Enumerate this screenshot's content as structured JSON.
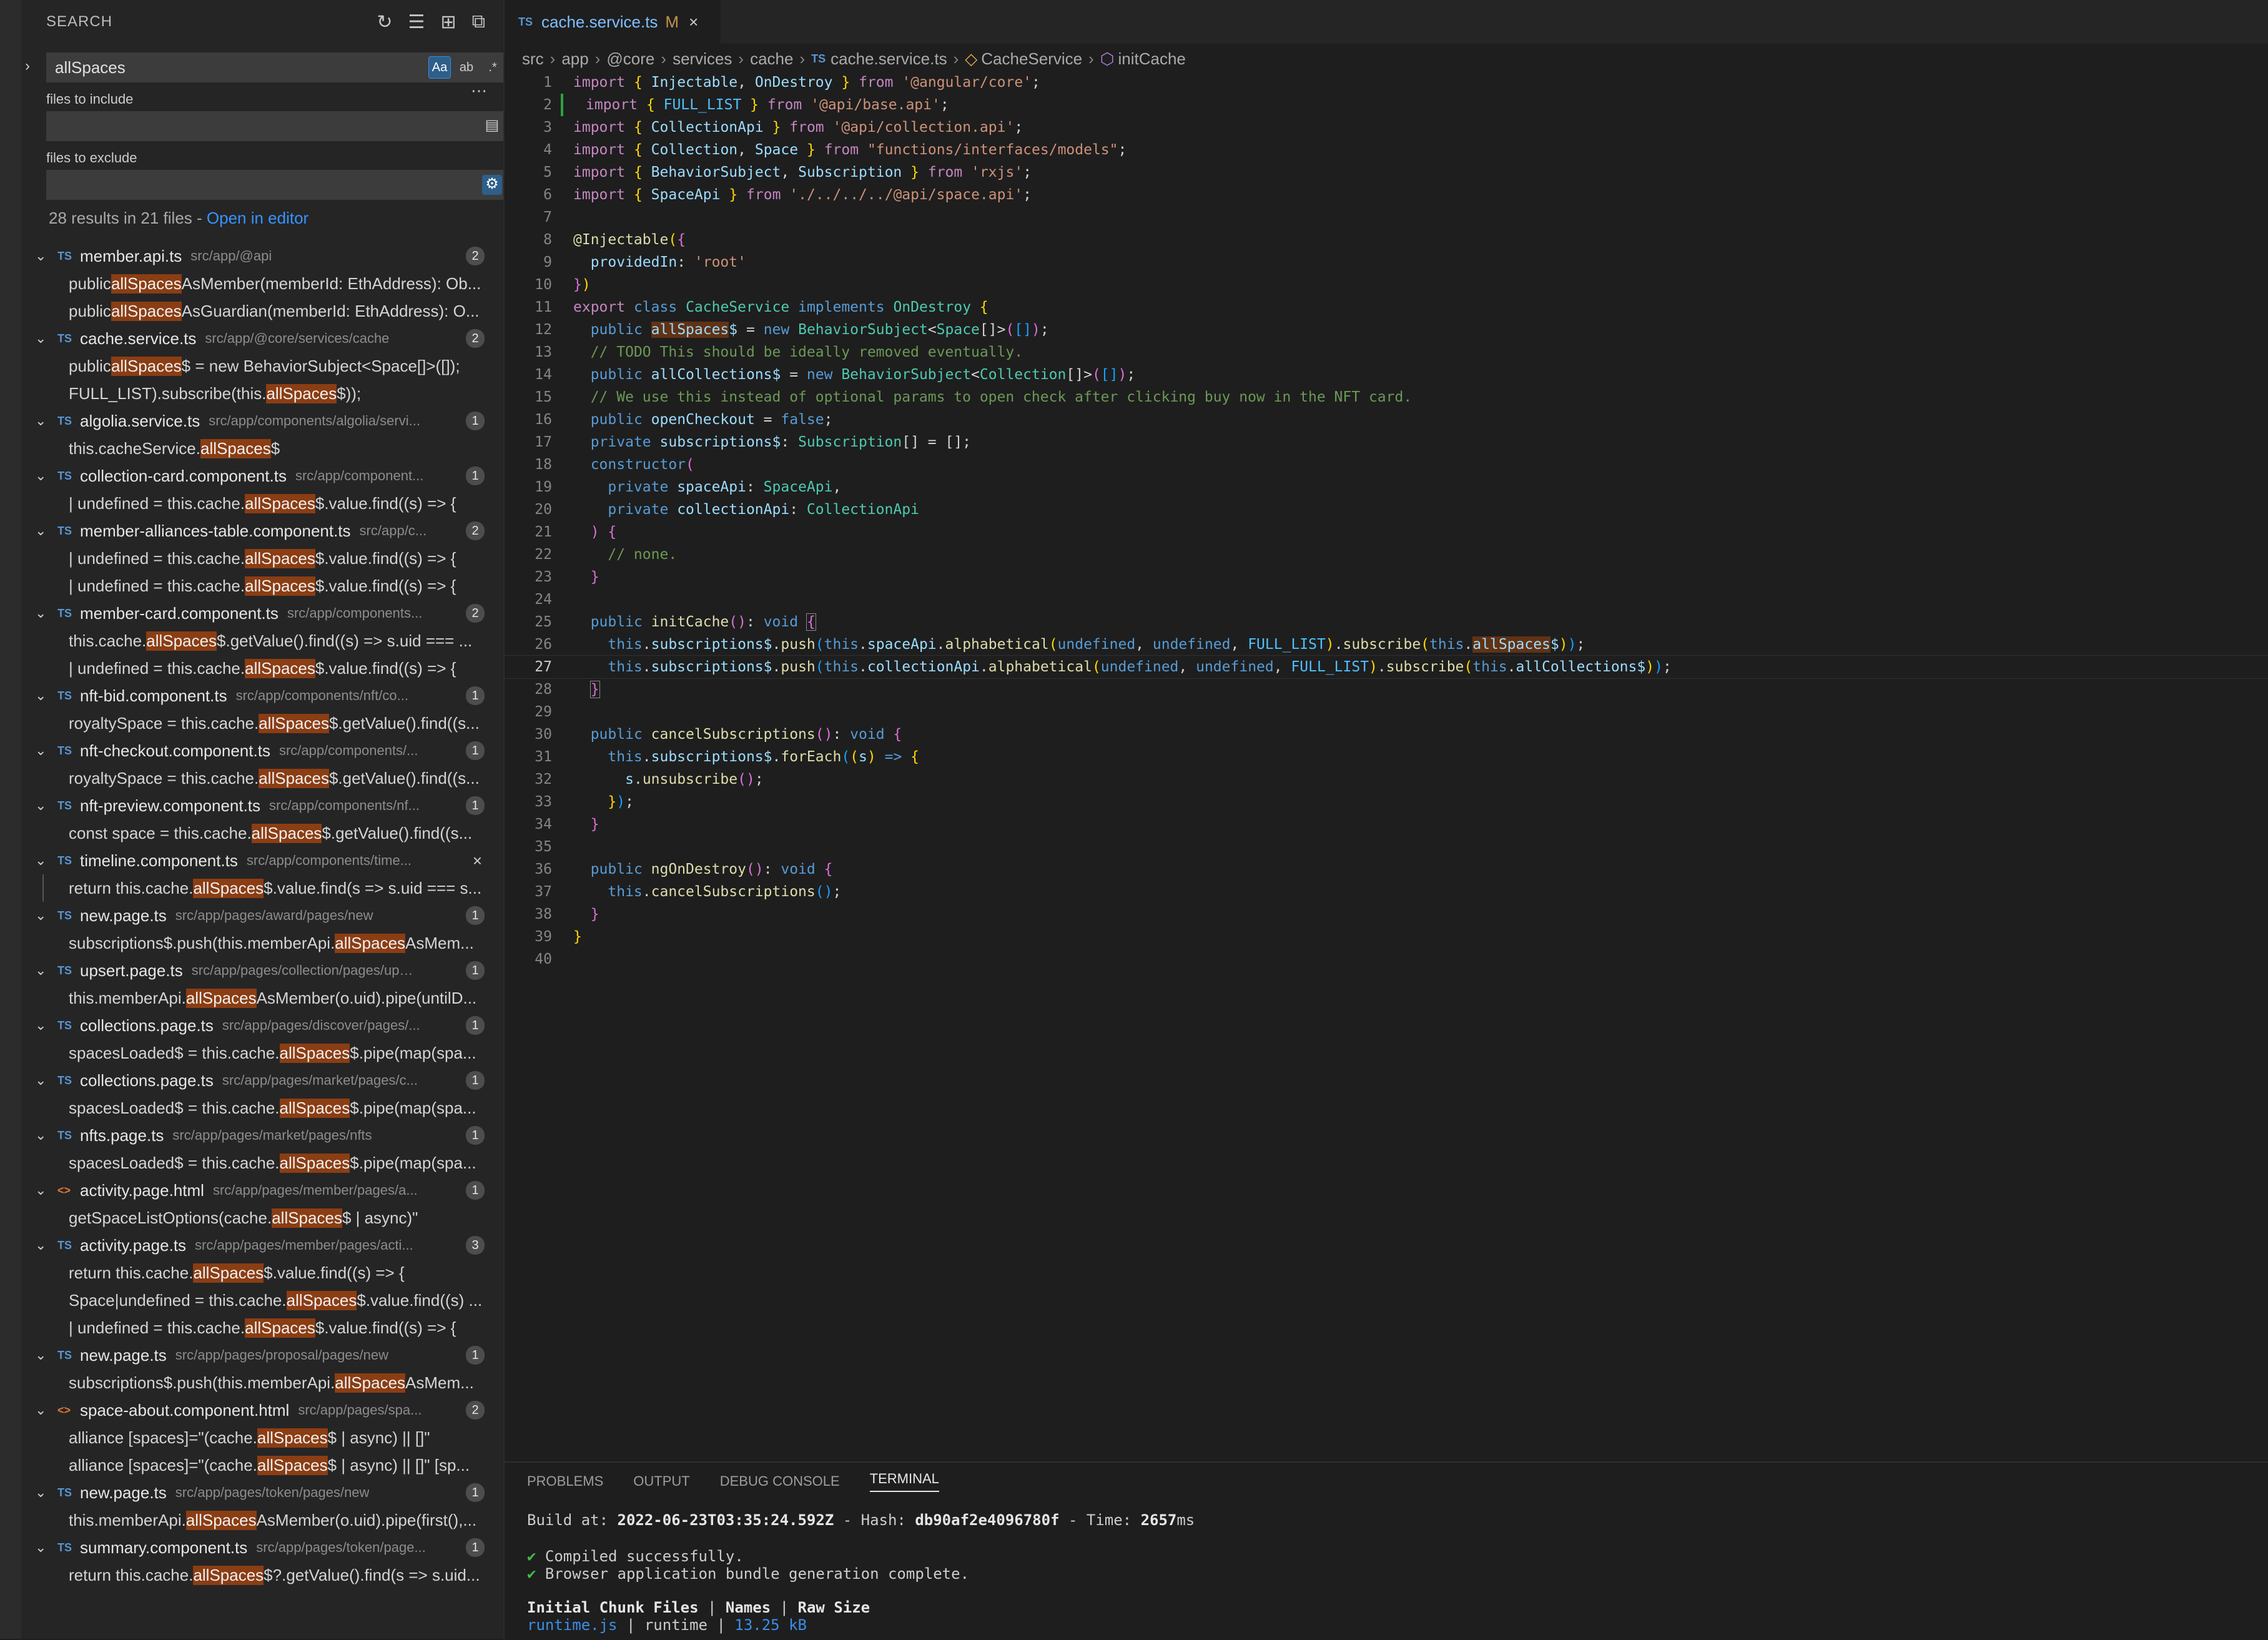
{
  "sidebar": {
    "title": "SEARCH",
    "search_query": "allSpaces",
    "options": {
      "match_case": "Aa",
      "whole_word": "ab",
      "regex": ".*"
    },
    "include_label": "files to include",
    "include_value": "",
    "exclude_label": "files to exclude",
    "exclude_value": "",
    "summary_text": "28 results in 21 files - ",
    "open_in_editor": "Open in editor",
    "results": [
      {
        "name": "member.api.ts",
        "path": "src/app/@api",
        "count": "2",
        "type": "TS",
        "matches": [
          [
            "public ",
            "allSpaces",
            "AsMember(memberId: EthAddress): Ob..."
          ],
          [
            "public ",
            "allSpaces",
            "AsGuardian(memberId: EthAddress): O..."
          ]
        ]
      },
      {
        "name": "cache.service.ts",
        "path": "src/app/@core/services/cache",
        "count": "2",
        "type": "TS",
        "matches": [
          [
            "public ",
            "allSpaces",
            "$ = new BehaviorSubject<Space[]>([]);"
          ],
          [
            "FULL_LIST).subscribe(this.",
            "allSpaces",
            "$));"
          ]
        ]
      },
      {
        "name": "algolia.service.ts",
        "path": "src/app/components/algolia/servi...",
        "count": "1",
        "type": "TS",
        "matches": [
          [
            "this.cacheService.",
            "allSpaces",
            "$"
          ]
        ]
      },
      {
        "name": "collection-card.component.ts",
        "path": "src/app/component...",
        "count": "1",
        "type": "TS",
        "matches": [
          [
            "| undefined = this.cache.",
            "allSpaces",
            "$.value.find((s) => {"
          ]
        ]
      },
      {
        "name": "member-alliances-table.component.ts",
        "path": "src/app/c...",
        "count": "2",
        "type": "TS",
        "matches": [
          [
            "| undefined = this.cache.",
            "allSpaces",
            "$.value.find((s) => {"
          ],
          [
            "| undefined = this.cache.",
            "allSpaces",
            "$.value.find((s) => {"
          ]
        ]
      },
      {
        "name": "member-card.component.ts",
        "path": "src/app/components...",
        "count": "2",
        "type": "TS",
        "matches": [
          [
            "this.cache.",
            "allSpaces",
            "$.getValue().find((s) => s.uid === ..."
          ],
          [
            "| undefined = this.cache.",
            "allSpaces",
            "$.value.find((s) => {"
          ]
        ]
      },
      {
        "name": "nft-bid.component.ts",
        "path": "src/app/components/nft/co...",
        "count": "1",
        "type": "TS",
        "matches": [
          [
            "royaltySpace = this.cache.",
            "allSpaces",
            "$.getValue().find((s..."
          ]
        ]
      },
      {
        "name": "nft-checkout.component.ts",
        "path": "src/app/components/...",
        "count": "1",
        "type": "TS",
        "matches": [
          [
            "royaltySpace = this.cache.",
            "allSpaces",
            "$.getValue().find((s..."
          ]
        ]
      },
      {
        "name": "nft-preview.component.ts",
        "path": "src/app/components/nf...",
        "count": "1",
        "type": "TS",
        "matches": [
          [
            "const space = this.cache.",
            "allSpaces",
            "$.getValue().find((s..."
          ]
        ]
      },
      {
        "name": "timeline.component.ts",
        "path": "src/app/components/time...",
        "count": "",
        "close": true,
        "type": "TS",
        "matches": [
          [
            "return this.cache.",
            "allSpaces",
            "$.value.find(s => s.uid === s..."
          ]
        ]
      },
      {
        "name": "new.page.ts",
        "path": "src/app/pages/award/pages/new",
        "count": "1",
        "type": "TS",
        "matches": [
          [
            "subscriptions$.push(this.memberApi.",
            "allSpaces",
            "AsMem..."
          ]
        ]
      },
      {
        "name": "upsert.page.ts",
        "path": "src/app/pages/collection/pages/ups...",
        "count": "1",
        "type": "TS",
        "matches": [
          [
            "this.memberApi.",
            "allSpaces",
            "AsMember(o.uid).pipe(untilD..."
          ]
        ]
      },
      {
        "name": "collections.page.ts",
        "path": "src/app/pages/discover/pages/...",
        "count": "1",
        "type": "TS",
        "matches": [
          [
            "spacesLoaded$ = this.cache.",
            "allSpaces",
            "$.pipe(map(spa..."
          ]
        ]
      },
      {
        "name": "collections.page.ts",
        "path": "src/app/pages/market/pages/c...",
        "count": "1",
        "type": "TS",
        "matches": [
          [
            "spacesLoaded$ = this.cache.",
            "allSpaces",
            "$.pipe(map(spa..."
          ]
        ]
      },
      {
        "name": "nfts.page.ts",
        "path": "src/app/pages/market/pages/nfts",
        "count": "1",
        "type": "TS",
        "matches": [
          [
            "spacesLoaded$ = this.cache.",
            "allSpaces",
            "$.pipe(map(spa..."
          ]
        ]
      },
      {
        "name": "activity.page.html",
        "path": "src/app/pages/member/pages/a...",
        "count": "1",
        "type": "<>",
        "matches": [
          [
            "getSpaceListOptions(cache.",
            "allSpaces",
            "$ | async)\""
          ]
        ]
      },
      {
        "name": "activity.page.ts",
        "path": "src/app/pages/member/pages/acti...",
        "count": "3",
        "type": "TS",
        "matches": [
          [
            "return this.cache.",
            "allSpaces",
            "$.value.find((s) => {"
          ],
          [
            "Space|undefined = this.cache.",
            "allSpaces",
            "$.value.find((s) ..."
          ],
          [
            "| undefined = this.cache.",
            "allSpaces",
            "$.value.find((s) => {"
          ]
        ]
      },
      {
        "name": "new.page.ts",
        "path": "src/app/pages/proposal/pages/new",
        "count": "1",
        "type": "TS",
        "matches": [
          [
            "subscriptions$.push(this.memberApi.",
            "allSpaces",
            "AsMem..."
          ]
        ]
      },
      {
        "name": "space-about.component.html",
        "path": "src/app/pages/spa...",
        "count": "2",
        "type": "<>",
        "matches": [
          [
            "alliance [spaces]=\"(cache.",
            "allSpaces",
            "$ | async) || []\""
          ],
          [
            "alliance [spaces]=\"(cache.",
            "allSpaces",
            "$ | async) || []\" [sp..."
          ]
        ]
      },
      {
        "name": "new.page.ts",
        "path": "src/app/pages/token/pages/new",
        "count": "1",
        "type": "TS",
        "matches": [
          [
            "this.memberApi.",
            "allSpaces",
            "AsMember(o.uid).pipe(first(),..."
          ]
        ]
      },
      {
        "name": "summary.component.ts",
        "path": "src/app/pages/token/page...",
        "count": "1",
        "type": "TS",
        "matches": [
          [
            "return this.cache.",
            "allSpaces",
            "$?.getValue().find(s => s.uid..."
          ]
        ]
      }
    ]
  },
  "editor": {
    "tab_icon": "TS",
    "tab_name": "cache.service.ts",
    "tab_status": "M",
    "breadcrumbs": [
      "src",
      "app",
      "@core",
      "services",
      "cache",
      "cache.service.ts",
      "CacheService",
      "initCache"
    ],
    "current_line": 27,
    "line_count": 40
  },
  "panel": {
    "tabs": [
      "PROBLEMS",
      "OUTPUT",
      "DEBUG CONSOLE",
      "TERMINAL"
    ],
    "active_tab": "TERMINAL",
    "build_prefix": "Build at: ",
    "build_time": "2022-06-23T03:35:24.592Z",
    "hash_label": " - Hash: ",
    "hash": "db90af2e4096780f",
    "time_label": " - Time: ",
    "time": "2657",
    "time_unit": "ms",
    "compiled": "Compiled successfully.",
    "bundle": "Browser application bundle generation complete.",
    "table_header": [
      "Initial Chunk Files",
      "Names",
      "Raw Size"
    ],
    "table_row": [
      "runtime.js",
      "runtime",
      "13.25 kB"
    ]
  },
  "colors": {
    "accent": "#3794ff",
    "match_highlight": "#8b3d13",
    "modified": "#c29348",
    "success": "#3fb950"
  }
}
